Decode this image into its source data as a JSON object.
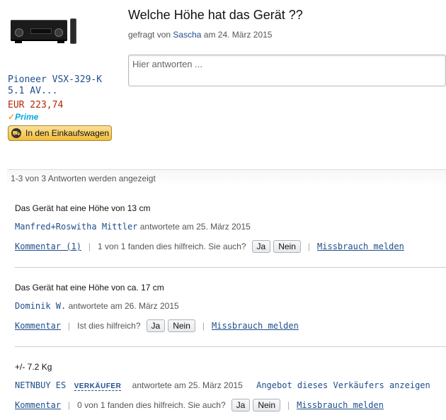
{
  "product": {
    "image_icon": "av-receiver-image",
    "title_line1": "Pioneer VSX-329-K",
    "title_line2": "5.1 AV...",
    "price": "EUR 223,74",
    "prime_label": "Prime",
    "cart_button_label": "In den Einkaufswagen"
  },
  "question": {
    "title": "Welche Höhe hat das Gerät ??",
    "asked_prefix": "gefragt von",
    "asker": "Sascha",
    "asked_suffix": "am 24. März 2015",
    "answer_placeholder": "Hier antworten ..."
  },
  "results_summary": "1-3 von 3 Antworten werden angezeigt",
  "answers": [
    {
      "text": "Das Gerät hat eine Höhe von 13 cm",
      "author": "Manfred+Roswitha Mittler",
      "answered": "antwortete am 25. März 2015",
      "comment_label": "Kommentar (1)",
      "helpful_text": "1 von 1 fanden dies hilfreich. Sie auch?",
      "yes_label": "Ja",
      "no_label": "Nein",
      "report_label": "Missbrauch melden"
    },
    {
      "text": "Das Gerät hat eine Höhe von ca. 17 cm",
      "author": "Dominik W.",
      "answered": "antwortete am 26. März 2015",
      "comment_label": "Kommentar",
      "helpful_text": "Ist dies hilfreich?",
      "yes_label": "Ja",
      "no_label": "Nein",
      "report_label": "Missbrauch melden"
    },
    {
      "text": "+/- 7.2 Kg",
      "author": "NETNBUY ES",
      "seller_badge": "VERKÄUFER",
      "answered": "antwortete am 25. März 2015",
      "offer_link": "Angebot dieses Verkäufers anzeigen",
      "comment_label": "Kommentar",
      "helpful_text": "0 von 1 fanden dies hilfreich. Sie auch?",
      "yes_label": "Ja",
      "no_label": "Nein",
      "report_label": "Missbrauch melden"
    }
  ],
  "colors": {
    "link": "#1f4e8c",
    "price": "#b12704",
    "prime": "#00a8e1",
    "cart_button": "#f2bd3a"
  }
}
